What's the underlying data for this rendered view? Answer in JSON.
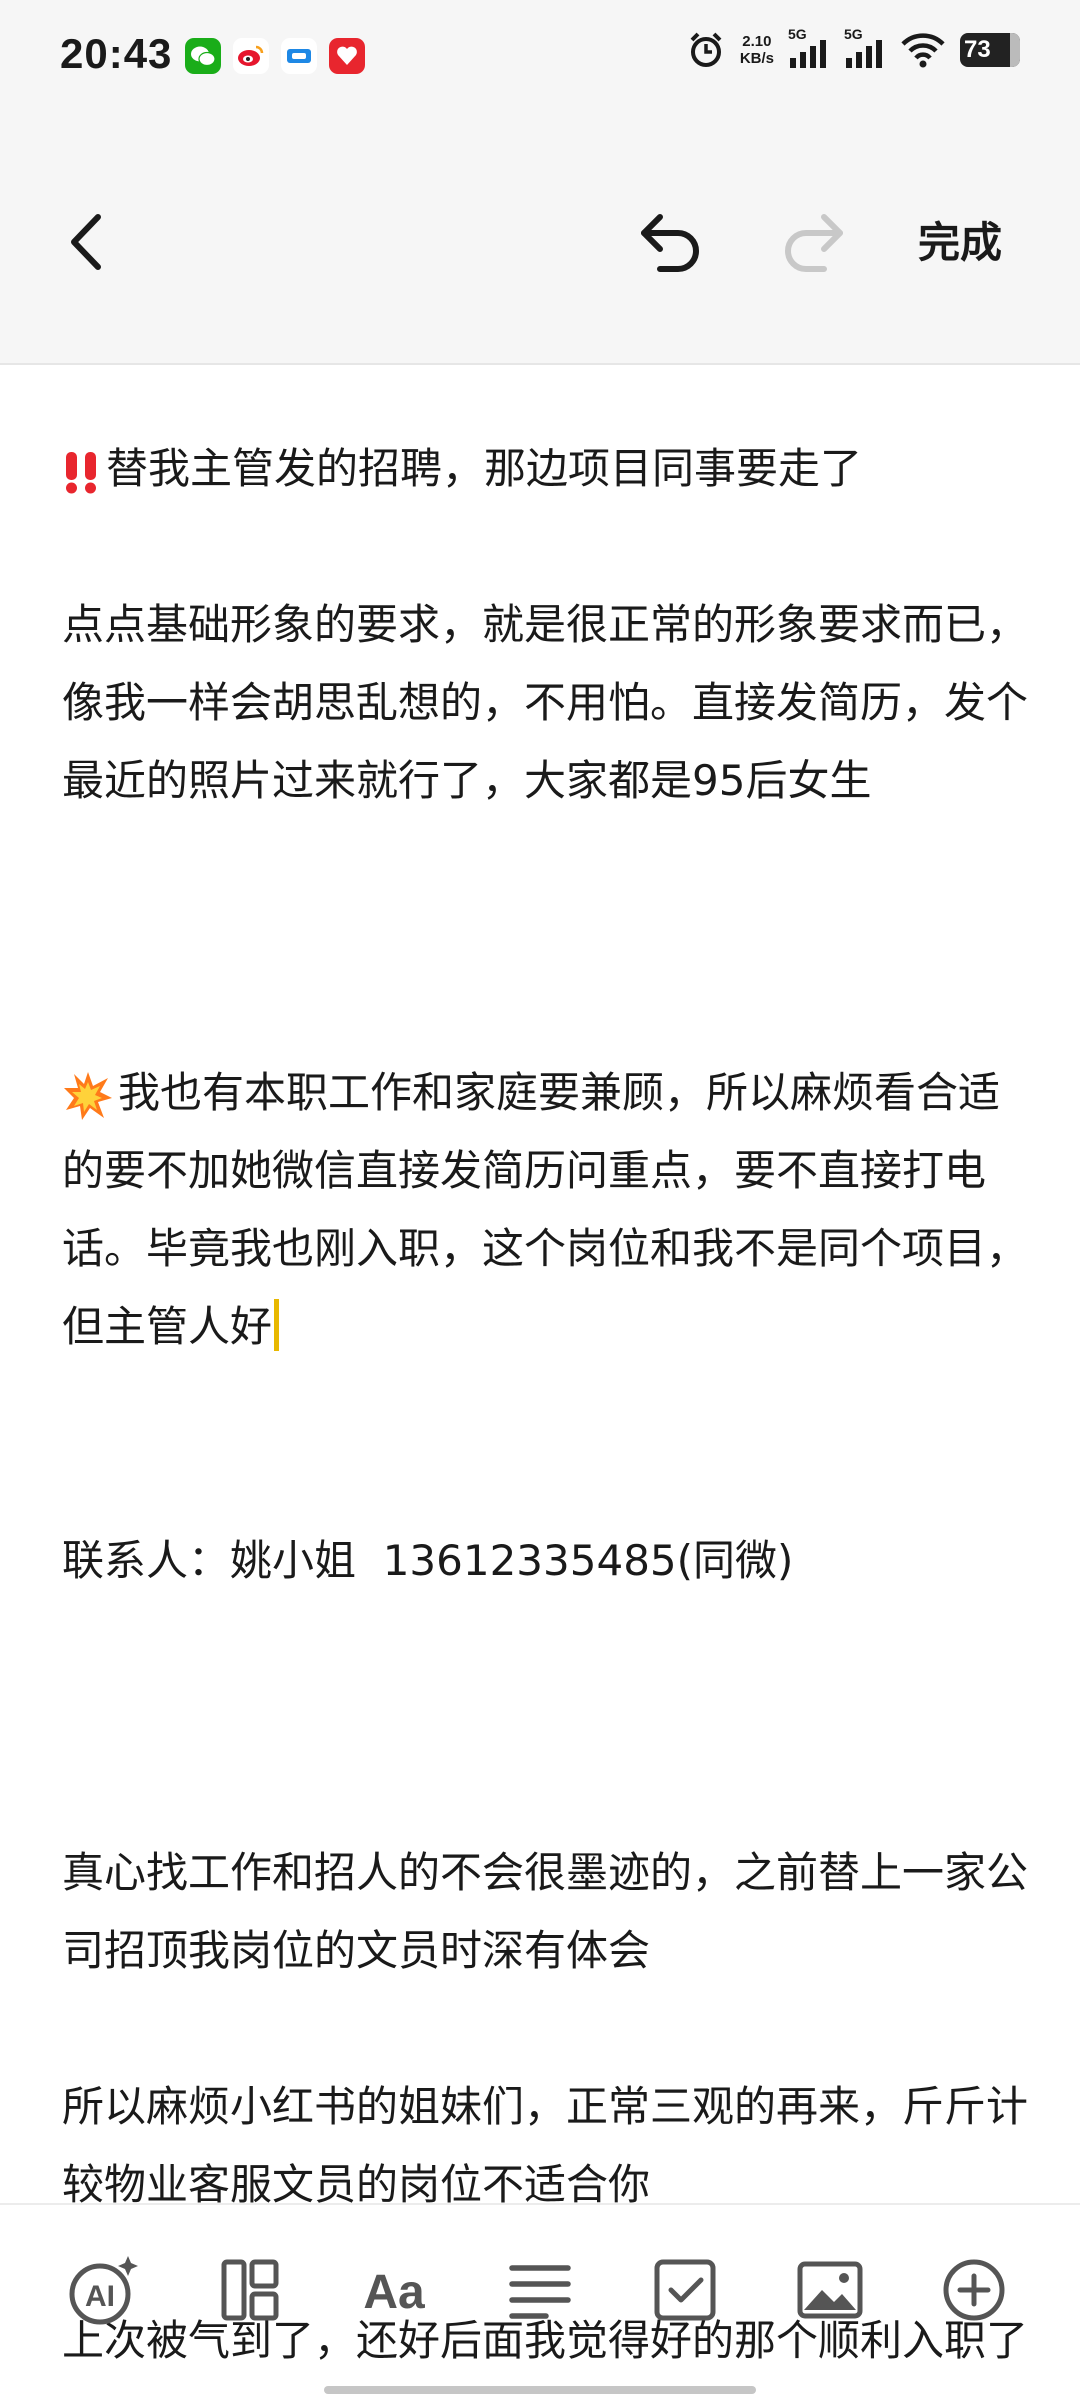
{
  "status": {
    "time": "20:43",
    "net_speed_value": "2.10",
    "net_speed_unit": "KB/s",
    "net1": "5G",
    "net2": "5G",
    "battery": "73"
  },
  "toolbar": {
    "done_label": "完成"
  },
  "note": {
    "p1": "替我主管发的招聘，那边项目同事要走了",
    "p2": "点点基础形象的要求，就是很正常的形象要求而已，像我一样会胡思乱想的，不用怕。直接发简历，发个最近的照片过来就行了，大家都是95后女生",
    "p3": "我也有本职工作和家庭要兼顾，所以麻烦看合适的要不加她微信直接发简历问重点，要不直接打电话。毕竟我也刚入职，这个岗位和我不是同个项目，但主管人好",
    "p3_contact": "联系人：姚小姐  13612335485(同微)",
    "p4": "真心找工作和招人的不会很墨迹的，之前替上一家公司招顶我岗位的文员时深有体会",
    "p5": "所以麻烦小红书的姐妹们，正常三观的再来，斤斤计较物业客服文员的岗位不适合你",
    "p6": "上次被气到了，还好后面我觉得好的那个顺利入职了"
  },
  "colors": {
    "cursor": "#e8b800",
    "emoji_red": "#e8262e",
    "toolbar_bg": "#f6f6f6"
  },
  "icons": [
    "back-icon",
    "undo-icon",
    "redo-icon",
    "ai-icon",
    "layout-icon",
    "text-format-icon",
    "align-icon",
    "checkbox-icon",
    "image-icon",
    "add-icon"
  ]
}
